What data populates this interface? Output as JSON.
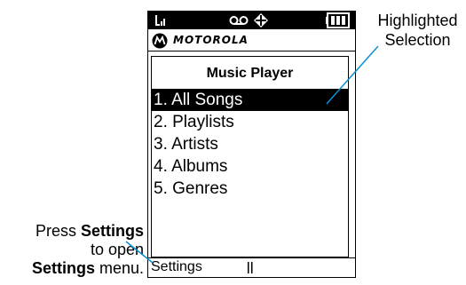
{
  "status_bar": {
    "icons": [
      "signal-icon",
      "voicemail-icon",
      "location-icon",
      "battery-icon"
    ]
  },
  "brand": {
    "name": "MOTOROLA",
    "logo": "motorola-logo"
  },
  "screen": {
    "title": "Music Player",
    "menu_items": [
      {
        "label": "1. All Songs",
        "selected": true
      },
      {
        "label": "2. Playlists",
        "selected": false
      },
      {
        "label": "3. Artists",
        "selected": false
      },
      {
        "label": "4. Albums",
        "selected": false
      },
      {
        "label": "5. Genres",
        "selected": false
      }
    ]
  },
  "soft_keys": {
    "left": "Settings",
    "center_icon": "center-key-icon"
  },
  "callouts": {
    "highlight_line1": "Highlighted",
    "highlight_line2": "Selection",
    "press_word1": "Press",
    "press_word2": "Settings",
    "press_line2": "to open",
    "press_line3_bold": "Settings",
    "press_line3_rest": " menu."
  }
}
